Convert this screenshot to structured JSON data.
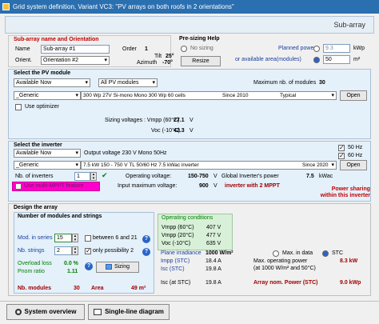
{
  "window": {
    "title": "Grid system definition, Variant VC3:  \"PV arrays  on both  roofs in 2 orientations\""
  },
  "header": {
    "title": "Sub-array"
  },
  "subarray": {
    "section_title": "Sub-array name and Orientation",
    "name_label": "Name",
    "name_value": "Sub-array #1",
    "orient_label": "Orient.",
    "orient_value": "Orientation #2",
    "order_label": "Order",
    "order_value": "1",
    "tilt_label": "Tilt",
    "tilt_value": "25°",
    "azimuth_label": "Azimuth",
    "azimuth_value": "-70°"
  },
  "presizing": {
    "title": "Pre-sizing Help",
    "no_sizing": "No sizing",
    "resize": "Resize",
    "planned_power_label": "Planned power",
    "planned_power_value": "9.3",
    "planned_power_unit": "kWp",
    "area_label": "or available area(modules)",
    "area_value": "50",
    "area_unit": "m²"
  },
  "pvmodule": {
    "section_title": "Select the PV module",
    "filter1": "Available Now",
    "filter2": "All PV modules",
    "max_modules_label": "Maximum nb. of modules",
    "max_modules_value": "30",
    "manufacturer": "_Generic",
    "model": "300 Wp 27V      Si-mono      Mono 300 Wp 60 cells",
    "since": "Since 2010",
    "typical": "Typical",
    "open": "Open",
    "use_optimizer": "Use optimizer",
    "vmpp_label": "Sizing voltages :  Vmpp (60°C)",
    "vmpp_value": "27.1",
    "vmpp_unit": "V",
    "voc_label": "Voc (-10°C)",
    "voc_value": "42.3",
    "voc_unit": "V"
  },
  "inverter": {
    "section_title": "Select the inverter",
    "filter": "Available Now",
    "output_label": "Output voltage 230 V Mono 50Hz",
    "hz50": "50 Hz",
    "hz60": "60 Hz",
    "manufacturer": "_Generic",
    "model": "7.5 kW      150 - 750 V   TL      50/60 Hz   7.5 kWac inverter",
    "since": "Since 2020",
    "open": "Open",
    "nb_label": "Nb. of inverters",
    "nb_value": "1",
    "op_voltage_label": "Operating voltage:",
    "op_voltage_value": "150-750",
    "op_voltage_unit": "V",
    "global_power_label": "Global Inverter's power",
    "global_power_value": "7.5",
    "global_power_unit": "kWac",
    "input_max_label": "Input maximum voltage:",
    "input_max_value": "900",
    "input_max_unit": "V",
    "mppt_note": "inverter with 2 MPPT",
    "multi_mppt": "Use multi-MPPT feature",
    "power_sharing": "Power sharing within this inverter"
  },
  "design": {
    "section_title": "Design the array",
    "sub_title": "Number of modules and strings",
    "mod_series_label": "Mod. in series",
    "mod_series_value": "15",
    "between_label": "between 6 and 21",
    "nb_strings_label": "Nb. strings",
    "nb_strings_value": "2",
    "only_possibility": "only possibility 2",
    "overload_label": "Overload loss",
    "overload_value": "0.0 %",
    "pnom_label": "Pnom ratio",
    "pnom_value": "1.11",
    "sizing_button": "Sizing",
    "nb_modules_label": "Nb. modules",
    "nb_modules_value": "30",
    "area_label": "Area",
    "area_value": "49 m²",
    "op_cond_title": "Operating conditions",
    "vmpp60_label": "Vmpp (60°C)",
    "vmpp60_value": "407 V",
    "vmpp20_label": "Vmpp (20°C)",
    "vmpp20_value": "477 V",
    "voc10_label": "Voc (-10°C)",
    "voc10_value": "635 V",
    "irradiance_label": "Plane irradiance",
    "irradiance_value": "1000 W/m²",
    "max_data": "Max. in data",
    "stc": "STC",
    "impp_label": "Impp (STC)",
    "impp_value": "18.4 A",
    "max_op_power_label": "Max. operating power",
    "max_op_power_value": "8.3 kW",
    "at_label": "(at 1000 W/m² and 50°C)",
    "isc_label": "Isc (STC)",
    "isc_value": "19.8 A",
    "isc_at_stc_label": "Isc (at STC)",
    "isc_at_stc_value": "19.8 A",
    "array_power_label": "Array nom. Power (STC)",
    "array_power_value": "9.0 kWp"
  },
  "bottom": {
    "system_overview": "System overview",
    "single_line": "Single-line diagram"
  }
}
